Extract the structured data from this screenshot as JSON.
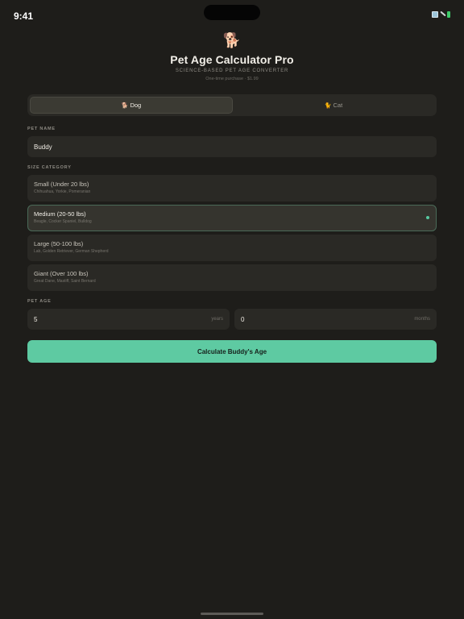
{
  "status_bar": {
    "time": "9:41"
  },
  "header": {
    "icon": "dog-icon",
    "icon_glyph": "🐕",
    "title": "Pet Age Calculator Pro",
    "subtitle": "SCIENCE-BASED PET AGE CONVERTER",
    "purchase_note": "One-time purchase · $1.99"
  },
  "pet_type": {
    "options": [
      {
        "label": "Dog",
        "glyph": "🐕",
        "icon": "dog-icon",
        "selected": true
      },
      {
        "label": "Cat",
        "glyph": "🐈",
        "icon": "cat-icon",
        "selected": false
      }
    ]
  },
  "pet_name": {
    "label": "PET NAME",
    "value": "Buddy"
  },
  "size_category": {
    "label": "SIZE CATEGORY",
    "options": [
      {
        "title": "Small (Under 20 lbs)",
        "examples": "Chihuahua, Yorkie, Pomeranian",
        "selected": false
      },
      {
        "title": "Medium (20-50 lbs)",
        "examples": "Beagle, Cocker Spaniel, Bulldog",
        "selected": true
      },
      {
        "title": "Large (50-100 lbs)",
        "examples": "Lab, Golden Retriever, German Shepherd",
        "selected": false
      },
      {
        "title": "Giant (Over 100 lbs)",
        "examples": "Great Dane, Mastiff, Saint Bernard",
        "selected": false
      }
    ]
  },
  "pet_age": {
    "label": "PET AGE",
    "years": {
      "value": "5",
      "unit": "years"
    },
    "months": {
      "value": "0",
      "unit": "months"
    }
  },
  "calculate_button": {
    "label": "Calculate Buddy's Age"
  },
  "colors": {
    "background": "#1e1d1a",
    "card": "#2a2925",
    "accent": "#5ecaa2",
    "icon_orange": "#d99a4d"
  }
}
